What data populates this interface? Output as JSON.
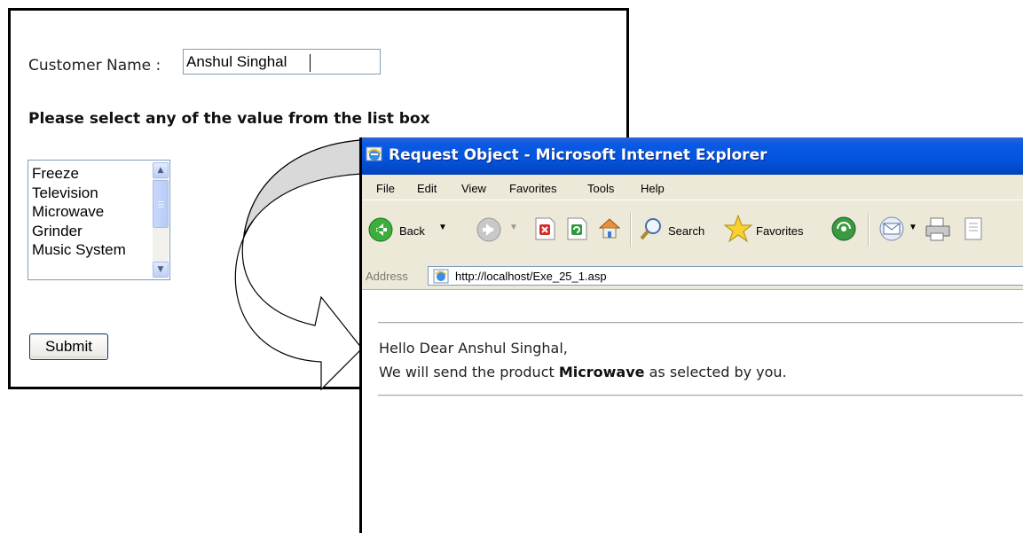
{
  "form": {
    "name_label": "Customer Name :",
    "name_value": "Anshul Singhal",
    "instruction": "Please select any of the value from the list box",
    "list_items": [
      "Freeze",
      "Television",
      "Microwave",
      "Grinder",
      "Music System"
    ],
    "submit_label": "Submit"
  },
  "browser": {
    "title": "Request Object - Microsoft Internet Explorer",
    "menu": [
      "File",
      "Edit",
      "View",
      "Favorites",
      "Tools",
      "Help"
    ],
    "toolbar": {
      "back_label": "Back",
      "search_label": "Search",
      "favorites_label": "Favorites"
    },
    "address_label": "Address",
    "address_url": "http://localhost/Exe_25_1.asp"
  },
  "response": {
    "greeting": "Hello Dear Anshul Singhal,",
    "message_prefix": "We will send the product",
    "product": "Microwave",
    "message_suffix": "as selected by you."
  },
  "colors": {
    "title_bar": "#0455e0",
    "chrome": "#ece9d8",
    "arrow_fill": "#d9d9d9"
  }
}
